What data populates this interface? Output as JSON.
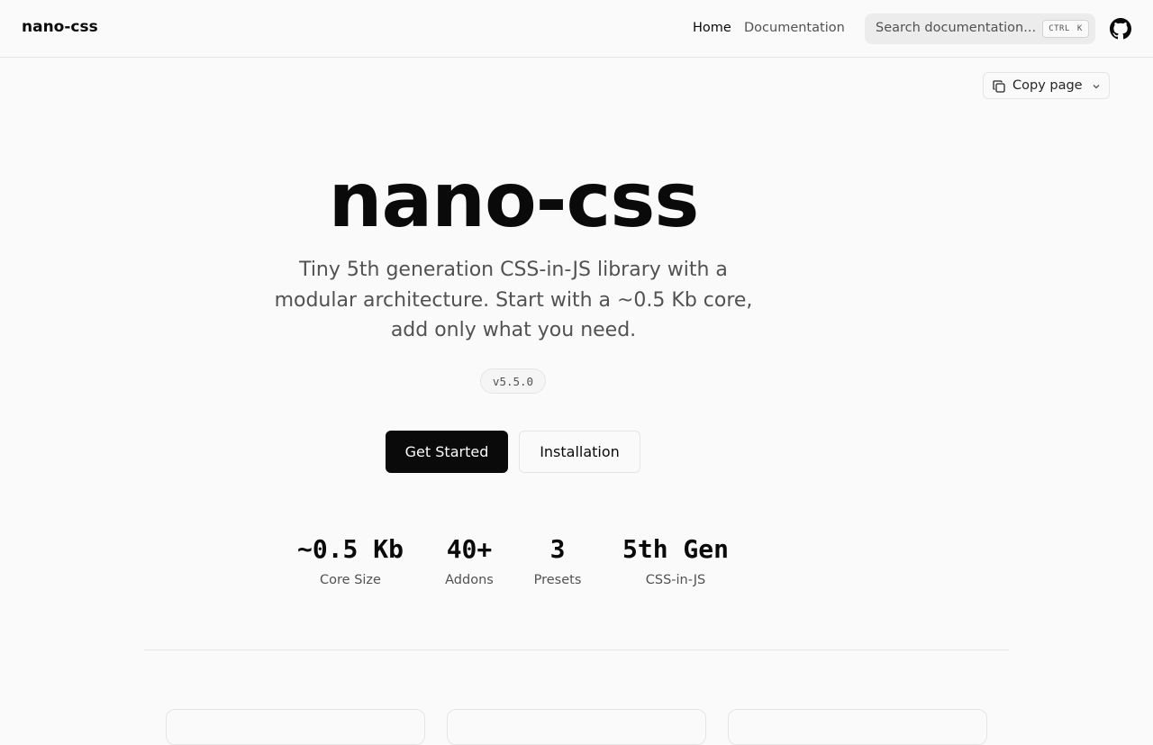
{
  "header": {
    "brand": "nano-css",
    "nav": [
      {
        "label": "Home"
      },
      {
        "label": "Documentation"
      }
    ],
    "search": {
      "placeholder": "Search documentation...",
      "shortcut_mod": "CTRL",
      "shortcut_key": "K"
    },
    "github_icon": "github-icon"
  },
  "page_actions": {
    "copy_label": "Copy page",
    "copy_icon": "copy-icon",
    "chevron_icon": "chevron-down-icon"
  },
  "hero": {
    "title": "nano-css",
    "subtitle": "Tiny 5th generation CSS-in-JS library with a modular architecture. Start with a ~0.5 Kb core, add only what you need.",
    "version": "v5.5.0",
    "primary_cta": "Get Started",
    "secondary_cta": "Installation"
  },
  "stats": [
    {
      "value": "~0.5 Kb",
      "label": "Core Size"
    },
    {
      "value": "40+",
      "label": "Addons"
    },
    {
      "value": "3",
      "label": "Presets"
    },
    {
      "value": "5th Gen",
      "label": "CSS-in-JS"
    }
  ],
  "colors": {
    "background": "#fafafa",
    "text": "#0a0a0a",
    "muted": "#525252",
    "border": "#e5e5e5",
    "primary_button": "#0a0a0a"
  }
}
